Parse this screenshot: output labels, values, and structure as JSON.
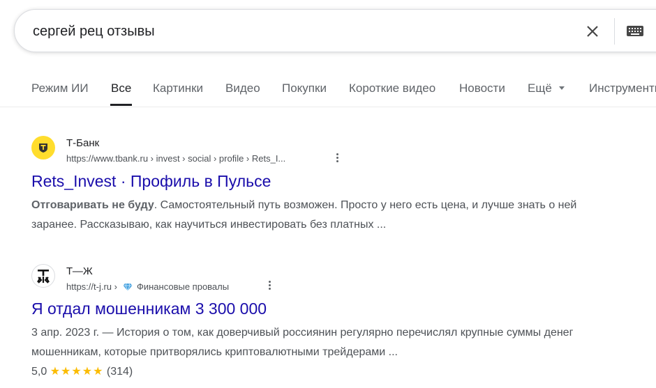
{
  "search": {
    "query": "сергей рец отзывы",
    "clear_icon": "close-icon",
    "keyboard_icon": "keyboard-icon"
  },
  "tabs": [
    {
      "label": "Режим ИИ"
    },
    {
      "label": "Все",
      "active": true
    },
    {
      "label": "Картинки"
    },
    {
      "label": "Видео"
    },
    {
      "label": "Покупки"
    },
    {
      "label": "Короткие видео"
    },
    {
      "label": "Новости"
    },
    {
      "label": "Ещё"
    },
    {
      "label": "Инструменты"
    }
  ],
  "results": [
    {
      "site_name": "Т-Банк",
      "url": "https://www.tbank.ru › invest › social › profile › Rets_I...",
      "title": "Rets_Invest · Профиль в Пульсе",
      "snippet_bold": "Отговаривать не буду",
      "snippet_rest": ". Самостоятельный путь возможен. Просто у него есть цена, и лучше знать о ней заранее. Рассказываю, как научиться инвестировать без платных ...",
      "favicon_color": "#ffdd2d"
    },
    {
      "site_name": "Т—Ж",
      "url_base": "https://t-j.ru ›",
      "url_section": "Финансовые провалы",
      "title": "Я отдал мошенникам 3 300 000",
      "snippet": "3 апр. 2023 г. — История о том, как доверчивый россиянин регулярно перечислял крупные суммы денег мошенникам, которые притворялись криптовалютными трейдерами ...",
      "rating_value": "5,0",
      "stars": "★★★★★",
      "rating_count": "(314)"
    }
  ],
  "colors": {
    "link": "#1a0dab",
    "star": "#fbbc04",
    "tbank_yellow": "#ffdd2d"
  }
}
